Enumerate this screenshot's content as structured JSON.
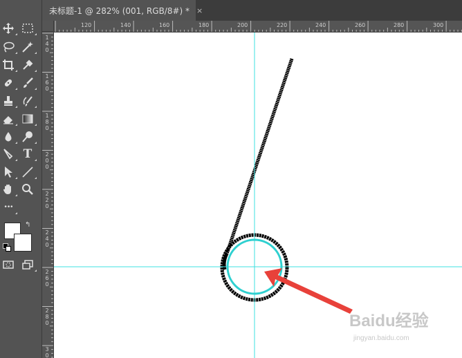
{
  "tab": {
    "title": "未标题-1 @ 282% (001, RGB/8#) *",
    "close": "×"
  },
  "ruler": {
    "horizontal": [
      "120",
      "140",
      "160",
      "180",
      "200",
      "220",
      "240",
      "260",
      "280",
      "300"
    ],
    "vertical": [
      "140",
      "160",
      "180",
      "200",
      "220",
      "240",
      "260",
      "280",
      "30"
    ]
  },
  "toolbar": {
    "tools": [
      "move-tool",
      "marquee-tool",
      "lasso-tool",
      "magic-wand-tool",
      "crop-tool",
      "eyedropper-tool",
      "healing-brush-tool",
      "brush-tool",
      "clone-stamp-tool",
      "history-brush-tool",
      "eraser-tool",
      "gradient-tool",
      "blur-tool",
      "dodge-tool",
      "pen-tool",
      "type-tool",
      "path-selection-tool",
      "line-tool",
      "hand-tool",
      "zoom-tool",
      "more-tools",
      "quick-mask",
      "screen-mode"
    ],
    "type_glyph": "T",
    "more_glyph": "•••",
    "swap_glyph": "↰"
  },
  "colors": {
    "foreground": "#ffffff",
    "background": "#ffffff",
    "guide": "#3ee0e0",
    "stroke": "#000000",
    "arrow": "#e8413a"
  },
  "watermark": {
    "brand": "Baidu经验",
    "url": "jingyan.baidu.com"
  }
}
